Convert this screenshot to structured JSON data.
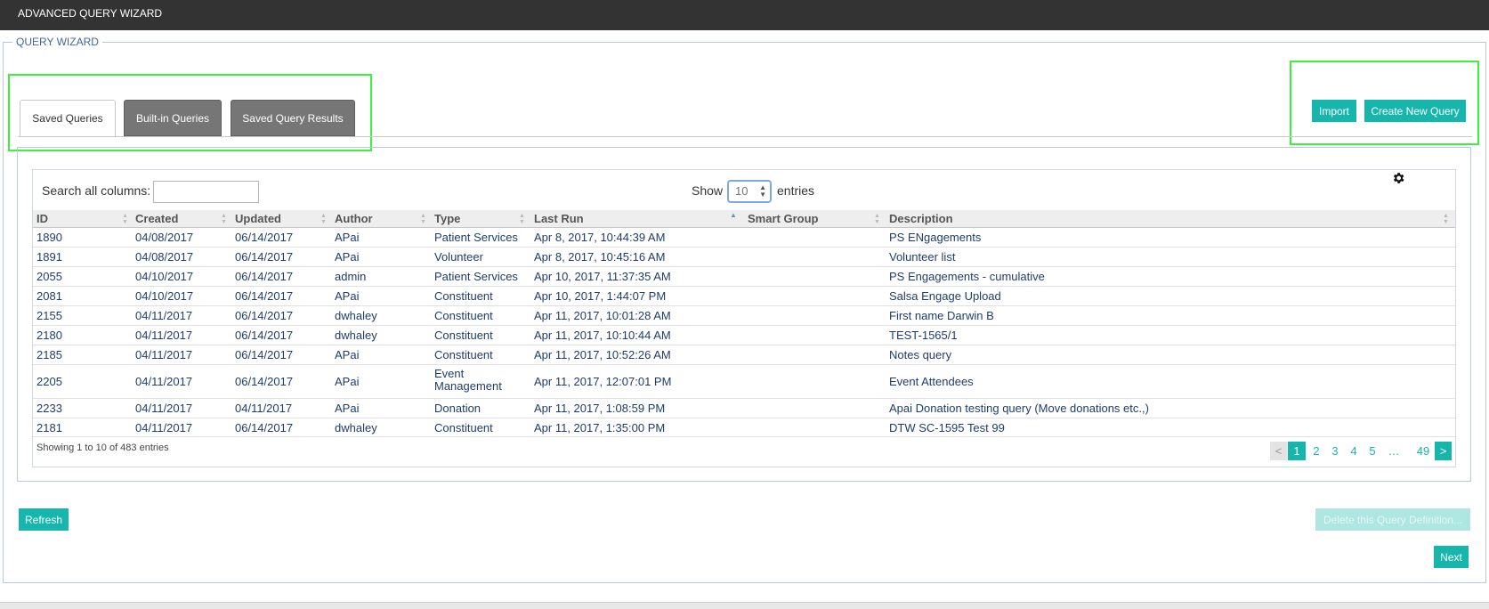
{
  "header": {
    "title": "ADVANCED QUERY WIZARD"
  },
  "wizard": {
    "legend": "QUERY WIZARD"
  },
  "tabs": [
    {
      "label": "Saved Queries"
    },
    {
      "label": "Built-in Queries"
    },
    {
      "label": "Saved Query Results"
    }
  ],
  "actions": {
    "import_label": "Import",
    "create_label": "Create New Query"
  },
  "table": {
    "search_label": "Search all columns:",
    "search_value": "",
    "show_label": "Show",
    "entries_value": "10",
    "entries_label": "entries",
    "columns": [
      "ID",
      "Created",
      "Updated",
      "Author",
      "Type",
      "Last Run",
      "Smart Group",
      "Description"
    ],
    "rows": [
      [
        "1890",
        "04/08/2017",
        "06/14/2017",
        "APai",
        "Patient Services",
        "Apr 8, 2017, 10:44:39 AM",
        "",
        "PS ENgagements"
      ],
      [
        "1891",
        "04/08/2017",
        "06/14/2017",
        "APai",
        "Volunteer",
        "Apr 8, 2017, 10:45:16 AM",
        "",
        "Volunteer list"
      ],
      [
        "2055",
        "04/10/2017",
        "06/14/2017",
        "admin",
        "Patient Services",
        "Apr 10, 2017, 11:37:35 AM",
        "",
        "PS Engagements - cumulative"
      ],
      [
        "2081",
        "04/10/2017",
        "06/14/2017",
        "APai",
        "Constituent",
        "Apr 10, 2017, 1:44:07 PM",
        "",
        "Salsa Engage Upload"
      ],
      [
        "2155",
        "04/11/2017",
        "06/14/2017",
        "dwhaley",
        "Constituent",
        "Apr 11, 2017, 10:01:28 AM",
        "",
        "First name Darwin B"
      ],
      [
        "2180",
        "04/11/2017",
        "06/14/2017",
        "dwhaley",
        "Constituent",
        "Apr 11, 2017, 10:10:44 AM",
        "",
        "TEST-1565/1"
      ],
      [
        "2185",
        "04/11/2017",
        "06/14/2017",
        "APai",
        "Constituent",
        "Apr 11, 2017, 10:52:26 AM",
        "",
        "Notes query"
      ],
      [
        "2205",
        "04/11/2017",
        "06/14/2017",
        "APai",
        "Event Management",
        "Apr 11, 2017, 12:07:01 PM",
        "",
        "Event Attendees"
      ],
      [
        "2233",
        "04/11/2017",
        "04/11/2017",
        "APai",
        "Donation",
        "Apr 11, 2017, 1:08:59 PM",
        "",
        "Apai Donation testing query (Move donations etc.,)"
      ],
      [
        "2181",
        "04/11/2017",
        "06/14/2017",
        "dwhaley",
        "Constituent",
        "Apr 11, 2017, 1:35:00 PM",
        "",
        "DTW SC-1595 Test 99"
      ]
    ],
    "showing_text": "Showing 1 to 10 of 483 entries",
    "pagination": {
      "prev": "<",
      "pages": [
        "1",
        "2",
        "3",
        "4",
        "5",
        "…",
        "49"
      ],
      "next": ">"
    }
  },
  "footer": {
    "refresh_label": "Refresh",
    "delete_label": "Delete this Query Definition...",
    "next_label": "Next"
  },
  "colors": {
    "accent": "#16b6ad",
    "topbar": "#333333",
    "highlight": "#3ef03e",
    "link_text": "#1f3d6b"
  },
  "icons": {
    "settings": "gear-icon",
    "sort": "sort-arrows-icon"
  }
}
